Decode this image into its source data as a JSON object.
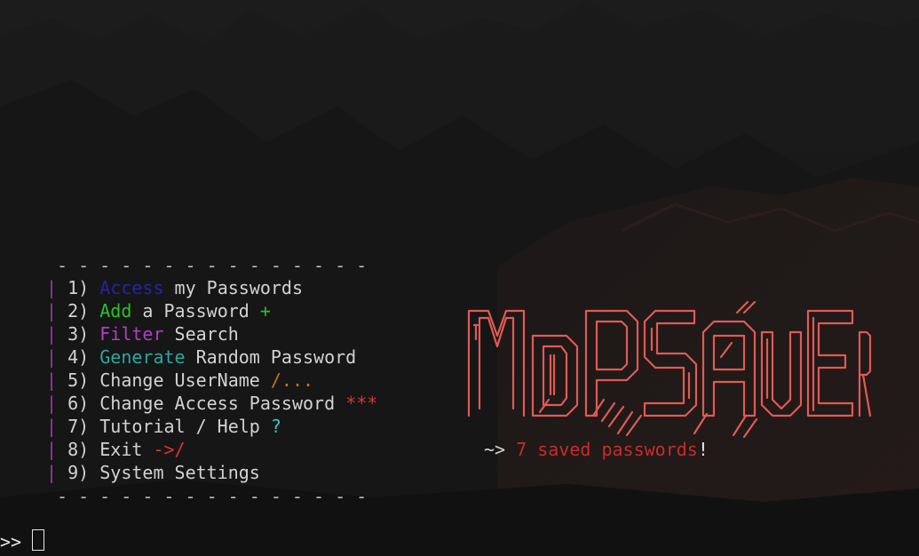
{
  "divider": "- - - - - - - - - - - - - - -",
  "bar": "|",
  "menu": [
    {
      "num": "1)",
      "keyword": "Access",
      "rest": " my Passwords",
      "suffix": ""
    },
    {
      "num": "2)",
      "keyword": "Add",
      "rest": " a Password ",
      "suffix": "+"
    },
    {
      "num": "3)",
      "keyword": "Filter",
      "rest": " Search",
      "suffix": ""
    },
    {
      "num": "4)",
      "keyword": "Generate",
      "rest": " Random Password",
      "suffix": ""
    },
    {
      "num": "5)",
      "keyword": "",
      "rest": "Change UserName ",
      "suffix": "/..."
    },
    {
      "num": "6)",
      "keyword": "",
      "rest": "Change Access Password ",
      "suffix": "***"
    },
    {
      "num": "7)",
      "keyword": "",
      "rest": "Tutorial / Help ",
      "suffix": "?"
    },
    {
      "num": "8)",
      "keyword": "",
      "rest": "Exit ",
      "suffix": "->/"
    },
    {
      "num": "9)",
      "keyword": "",
      "rest": "System Settings",
      "suffix": ""
    }
  ],
  "logo": {
    "text": "MDPSAVER",
    "color": "#e05a55"
  },
  "status": {
    "arrow": "~> ",
    "count_text": "7 saved passwords",
    "excl": "!"
  },
  "prompt": ">> ",
  "colors": {
    "background": "#141414",
    "bar": "#9b3ba0",
    "access": "#2323a8",
    "add": "#28c228",
    "filter": "#b43cc8",
    "generate": "#2aa8a0",
    "status_red": "#c92b2b"
  }
}
